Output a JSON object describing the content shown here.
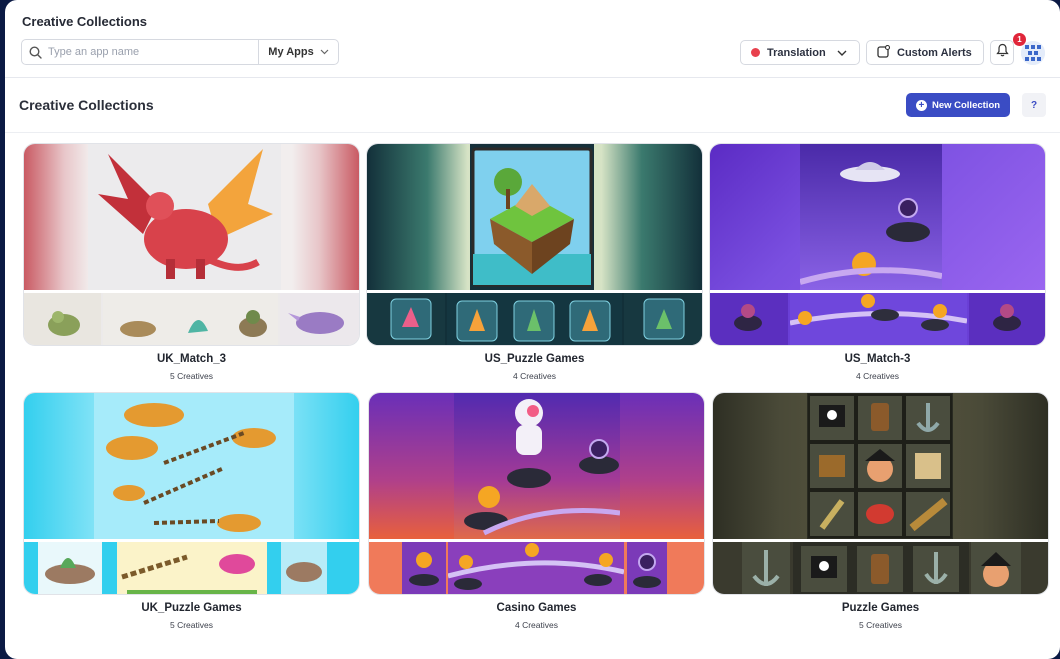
{
  "header": {
    "app_title": "Creative Collections",
    "search_placeholder": "Type an app name",
    "apps_dropdown": "My Apps",
    "translation_label": "Translation",
    "alerts_label": "Custom Alerts",
    "notification_count": "1"
  },
  "page": {
    "title": "Creative Collections",
    "new_collection_label": "New Collection",
    "help_label": "?"
  },
  "collections": [
    {
      "name": "UK_Match_3",
      "count": "5 Creatives"
    },
    {
      "name": "US_Puzzle Games",
      "count": "4 Creatives"
    },
    {
      "name": "US_Match-3",
      "count": "4 Creatives"
    },
    {
      "name": "UK_Puzzle Games",
      "count": "5 Creatives"
    },
    {
      "name": "Casino Games",
      "count": "4 Creatives"
    },
    {
      "name": "Puzzle Games",
      "count": "5 Creatives"
    }
  ],
  "colors": {
    "primary": "#3a4cc4",
    "status_red": "#e8414d",
    "badge_red": "#e0263a"
  }
}
